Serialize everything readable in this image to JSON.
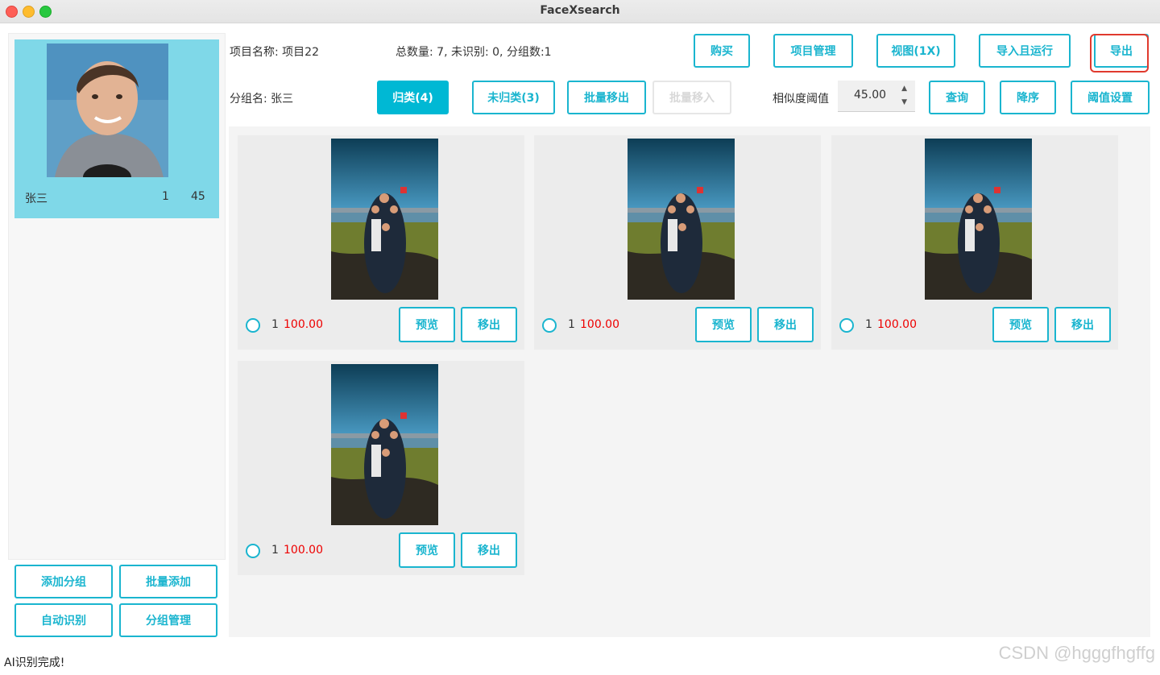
{
  "window": {
    "title": "FaceXsearch"
  },
  "header": {
    "project_name": "项目名称: 项目22",
    "stats": "总数量: 7, 未识别: 0, 分组数:1",
    "group_name": "分组名: 张三",
    "similarity_label": "相似度阈值",
    "similarity_value": "45.00"
  },
  "toolbar": {
    "buy": "购买",
    "project_manage": "项目管理",
    "view": "视图(1X)",
    "import_run": "导入且运行",
    "export": "导出",
    "classified": "归类(4)",
    "unclassified": "未归类(3)",
    "batch_remove": "批量移出",
    "batch_move_in": "批量移入",
    "query": "查询",
    "desc": "降序",
    "threshold_settings": "阈值设置"
  },
  "group": {
    "name": "张三",
    "count": "1",
    "threshold": "45"
  },
  "left_buttons": {
    "add_group": "添加分组",
    "batch_add": "批量添加",
    "auto_recognize": "自动识别",
    "group_manage": "分组管理"
  },
  "cards": [
    {
      "count": "1",
      "score": "100.00",
      "preview": "预览",
      "remove": "移出"
    },
    {
      "count": "1",
      "score": "100.00",
      "preview": "预览",
      "remove": "移出"
    },
    {
      "count": "1",
      "score": "100.00",
      "preview": "预览",
      "remove": "移出"
    },
    {
      "count": "1",
      "score": "100.00",
      "preview": "预览",
      "remove": "移出"
    }
  ],
  "status": "AI识别完成!",
  "watermark": "CSDN @hgggfhgffg",
  "colors": {
    "accent": "#1ab5cf",
    "primary_fill": "#00b8d4",
    "group_card": "#7fd8e8",
    "score": "#e00000",
    "highlight": "#e03a2e"
  }
}
